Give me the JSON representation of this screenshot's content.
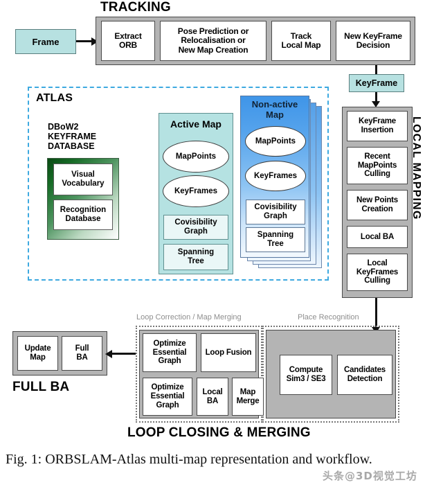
{
  "figure": {
    "caption": "Fig. 1: ORBSLAM-Atlas multi-map representation and workflow.",
    "watermark": "头条@3D视觉工坊"
  },
  "colors": {
    "frame_fill": "#b7e1e1",
    "keyframe_fill": "#b7e1e1",
    "process_container": "#b4b4b4",
    "atlas_dashed_border": "#3da9e0",
    "active_map_fill": "#b5e2e2",
    "nonactive_map_fill": "#3f95e8",
    "dbow2_gradient_from": "#0a4a14",
    "dbow2_gradient_to": "#ffffff",
    "node_fill": "#ffffff",
    "faint_label": "#8e8e8e"
  },
  "tracking": {
    "title": "TRACKING",
    "input_label": "Frame",
    "output_label": "KeyFrame",
    "steps": [
      "Extract\nORB",
      "Pose Prediction or\nRelocalisation or\nNew Map Creation",
      "Track\nLocal Map",
      "New KeyFrame\nDecision"
    ],
    "step_lines": [
      [
        "Extract",
        "ORB"
      ],
      [
        "Pose Prediction or",
        "Relocalisation or",
        "New Map Creation"
      ],
      [
        "Track",
        "Local Map"
      ],
      [
        "New KeyFrame",
        "Decision"
      ]
    ]
  },
  "atlas": {
    "title": "ATLAS",
    "database": {
      "title_lines": [
        "DBoW2",
        "KEYFRAME",
        "DATABASE"
      ],
      "items": [
        [
          "Visual",
          "Vocabulary"
        ],
        [
          "Recognition",
          "Database"
        ]
      ]
    },
    "active_map": {
      "title": "Active Map",
      "ellipses": [
        "MapPoints",
        "KeyFrames"
      ],
      "boxes": [
        [
          "Covisibility",
          "Graph"
        ],
        [
          "Spanning",
          "Tree"
        ]
      ]
    },
    "nonactive_map": {
      "title_lines": [
        "Non-active",
        "Map"
      ],
      "ellipses": [
        "MapPoints",
        "KeyFrames"
      ],
      "boxes": [
        [
          "Covisibility",
          "Graph"
        ],
        [
          "Spanning",
          "Tree"
        ]
      ],
      "stack_count": 4
    }
  },
  "local_mapping": {
    "title": "LOCAL MAPPING",
    "steps": [
      [
        "KeyFrame",
        "Insertion"
      ],
      [
        "Recent",
        "MapPoints",
        "Culling"
      ],
      [
        "New Points",
        "Creation"
      ],
      [
        "Local BA"
      ],
      [
        "Local",
        "KeyFrames",
        "Culling"
      ]
    ]
  },
  "full_ba": {
    "title": "FULL BA",
    "steps": [
      [
        "Update",
        "Map"
      ],
      [
        "Full",
        "BA"
      ]
    ]
  },
  "loop_closing": {
    "title": "LOOP CLOSING & MERGING",
    "sub_labels": {
      "left": "Loop Correction / Map Merging",
      "right": "Place Recognition"
    },
    "loop_correction_row1": [
      [
        "Optimize",
        "Essential",
        "Graph"
      ],
      [
        "Loop Fusion"
      ]
    ],
    "loop_correction_row2": [
      [
        "Optimize",
        "Essential",
        "Graph"
      ],
      [
        "Local",
        "BA"
      ],
      [
        "Map",
        "Merge"
      ]
    ],
    "place_recognition": [
      [
        "Compute",
        "Sim3 / SE3"
      ],
      [
        "Candidates",
        "Detection"
      ]
    ]
  }
}
